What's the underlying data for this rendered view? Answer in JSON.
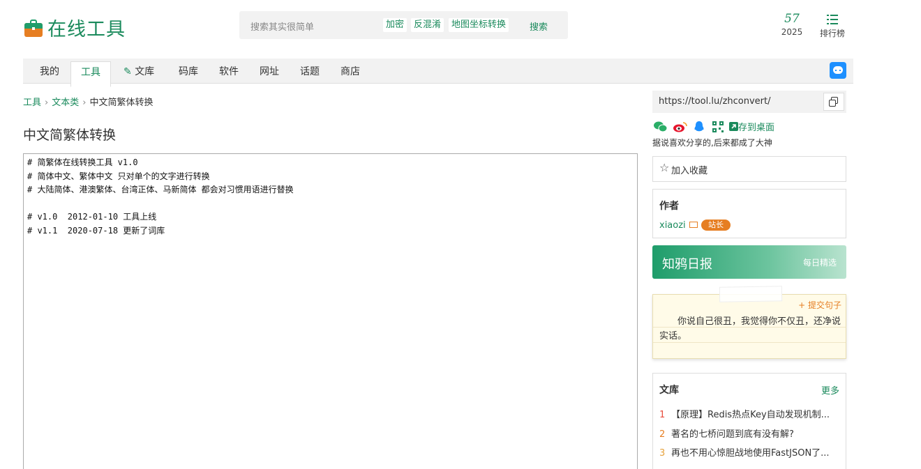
{
  "header": {
    "logo_text": "在线工具",
    "search": {
      "placeholder": "搜索其实很简单",
      "tags": [
        "加密",
        "反混淆",
        "地图坐标转换"
      ],
      "button": "搜索"
    },
    "stats": {
      "count": "57",
      "year": "2025",
      "ranking_label": "排行榜"
    }
  },
  "nav": {
    "items": [
      "我的",
      "工具",
      "文库",
      "码库",
      "软件",
      "网址",
      "话题",
      "商店"
    ],
    "active": "工具"
  },
  "breadcrumb": [
    "工具",
    "文本类",
    "中文简繁体转换"
  ],
  "page_title": "中文简繁体转换",
  "editor": {
    "content": "# 简繁体在线转换工具 v1.0\n# 简体中文、繁体中文 只对单个的文字进行转换\n# 大陆简体、港澳繁体、台湾正体、马新简体 都会对习惯用语进行替换\n\n# v1.0  2012-01-10 工具上线\n# v1.1  2020-07-18 更新了词库"
  },
  "sidebar": {
    "url": "https://tool.lu/zhconvert/",
    "save_desktop": "存到桌面",
    "share_note": "据说喜欢分享的,后来都成了大神",
    "favorite": "加入收藏",
    "author": {
      "title": "作者",
      "name": "xiaozi",
      "badge": "站长"
    },
    "daily": {
      "title": "知鸦日报",
      "subtitle": "每日精选"
    },
    "quote": {
      "submit": "+ 提交句子",
      "text": "你说自己很丑，我觉得你不仅丑，还净说实话。"
    },
    "library": {
      "title": "文库",
      "more": "更多",
      "items": [
        {
          "num": "1",
          "title": "【原理】Redis热点Key自动发现机制..."
        },
        {
          "num": "2",
          "title": "著名的七桥问题到底有没有解?"
        },
        {
          "num": "3",
          "title": "再也不用心惊胆战地使用FastJSON了..."
        }
      ],
      "num_colors": [
        "#e74c3c",
        "#e67e22",
        "#e6a23c"
      ]
    }
  },
  "colors": {
    "brand": "#1a8a5c",
    "accent": "#e67e22"
  }
}
